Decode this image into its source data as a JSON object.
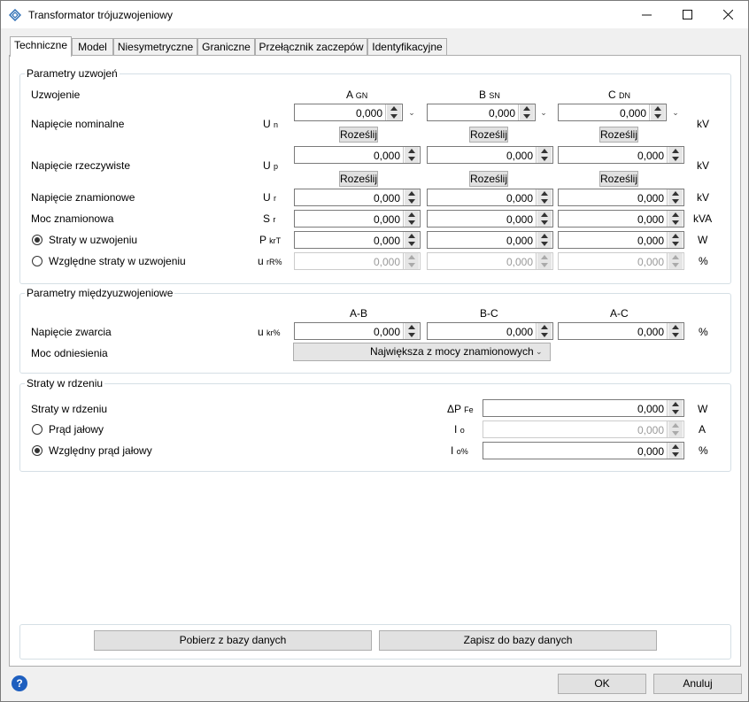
{
  "window": {
    "title": "Transformator trójuzwojeniowy",
    "minimize_icon": "minimize-icon",
    "maximize_icon": "maximize-icon",
    "close_icon": "close-icon",
    "app_icon": "diamond-app-icon"
  },
  "tabs": [
    {
      "label": "Techniczne",
      "active": true
    },
    {
      "label": "Model"
    },
    {
      "label": "Niesymetryczne"
    },
    {
      "label": "Graniczne"
    },
    {
      "label": "Przełącznik zaczepów"
    },
    {
      "label": "Identyfikacyjne"
    }
  ],
  "windings": {
    "title": "Parametry uzwojeń",
    "uzwojenie_label": "Uzwojenie",
    "columns": [
      {
        "main": "A",
        "sub": "GN"
      },
      {
        "main": "B",
        "sub": "SN"
      },
      {
        "main": "C",
        "sub": "DN"
      }
    ],
    "rozeslij": "Roześlij",
    "rows": {
      "nominal": {
        "label": "Napięcie nominalne",
        "sym": "U",
        "sub": "n",
        "unit": "kV",
        "values": [
          "0,000",
          "0,000",
          "0,000"
        ]
      },
      "actual": {
        "label": "Napięcie rzeczywiste",
        "sym": "U",
        "sub": "p",
        "unit": "kV",
        "values": [
          "0,000",
          "0,000",
          "0,000"
        ]
      },
      "rated": {
        "label": "Napięcie znamionowe",
        "sym": "U",
        "sub": "r",
        "unit": "kV",
        "values": [
          "0,000",
          "0,000",
          "0,000"
        ]
      },
      "power": {
        "label": "Moc znamionowa",
        "sym": "S",
        "sub": "r",
        "unit": "kVA",
        "values": [
          "0,000",
          "0,000",
          "0,000"
        ]
      },
      "losses": {
        "label": "Straty w uzwojeniu",
        "sym": "P",
        "sub": "krT",
        "unit": "W",
        "values": [
          "0,000",
          "0,000",
          "0,000"
        ],
        "selected": true
      },
      "rel_losses": {
        "label": "Względne straty w uzwojeniu",
        "sym": "u",
        "sub": "rR%",
        "unit": "%",
        "values": [
          "0,000",
          "0,000",
          "0,000"
        ],
        "selected": false
      }
    }
  },
  "inter": {
    "title": "Parametry międzyuzwojeniowe",
    "columns": [
      "A-B",
      "B-C",
      "A-C"
    ],
    "short": {
      "label": "Napięcie zwarcia",
      "sym": "u",
      "sub": "kr%",
      "unit": "%",
      "values": [
        "0,000",
        "0,000",
        "0,000"
      ]
    },
    "ref": {
      "label": "Moc odniesienia",
      "value": "Największa z mocy znamionowych"
    }
  },
  "core": {
    "title": "Straty w rdzeniu",
    "losses": {
      "label": "Straty w rdzeniu",
      "sym": "ΔP",
      "sub": "Fe",
      "unit": "W",
      "value": "0,000"
    },
    "current": {
      "label": "Prąd jałowy",
      "sym": "I",
      "sub": "o",
      "unit": "A",
      "value": "0,000",
      "selected": false
    },
    "rel_current": {
      "label": "Względny prąd jałowy",
      "sym": "I",
      "sub": "o%",
      "unit": "%",
      "value": "0,000",
      "selected": true
    }
  },
  "db": {
    "load": "Pobierz z bazy danych",
    "save": "Zapisz do bazy danych"
  },
  "footer": {
    "ok": "OK",
    "cancel": "Anuluj",
    "help_icon": "help-icon",
    "help_glyph": "?"
  }
}
